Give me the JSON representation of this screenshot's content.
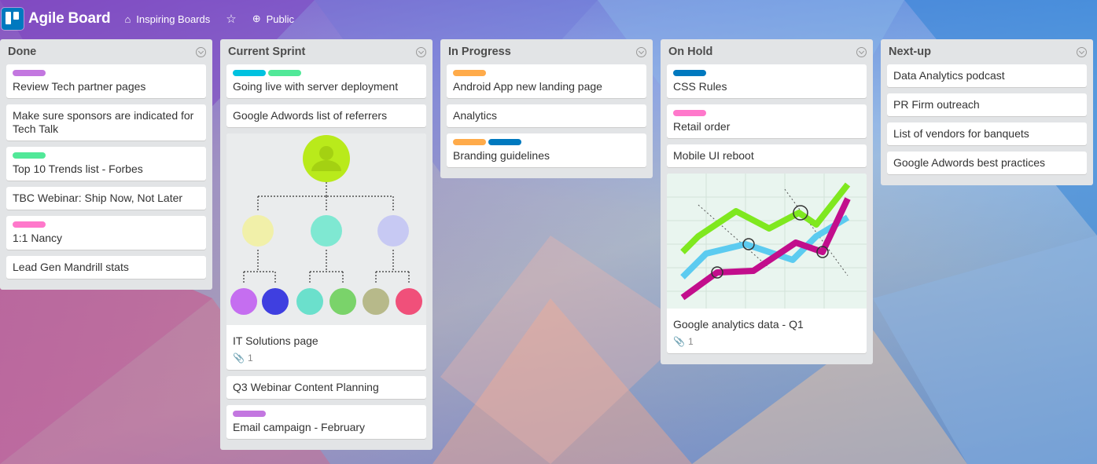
{
  "header": {
    "board_title": "Agile Board",
    "team": "Inspiring Boards",
    "visibility": "Public",
    "icons": [
      "trello-logo-icon",
      "team-icon",
      "star-icon",
      "globe-icon"
    ]
  },
  "lists": [
    {
      "title": "Done",
      "cards": [
        {
          "title": "Review Tech partner pages",
          "labels": [
            "#c377e0"
          ]
        },
        {
          "title": "Make sure sponsors are indicated for Tech Talk",
          "labels": []
        },
        {
          "title": "Top 10 Trends list - Forbes",
          "labels": [
            "#51e898"
          ]
        },
        {
          "title": "TBC Webinar: Ship Now, Not Later",
          "labels": []
        },
        {
          "title": "1:1 Nancy",
          "labels": [
            "#ff78cb"
          ]
        },
        {
          "title": "Lead Gen Mandrill stats",
          "labels": []
        }
      ]
    },
    {
      "title": "Current Sprint",
      "cards": [
        {
          "title": "Going live with server deployment",
          "labels": [
            "#00c2e0",
            "#51e898"
          ]
        },
        {
          "title": "Google Adwords list of referrers",
          "labels": []
        },
        {
          "title": "IT Solutions page",
          "labels": [],
          "cover": "org-chart",
          "attachments": "1"
        },
        {
          "title": "Q3 Webinar Content Planning",
          "labels": []
        },
        {
          "title": "Email campaign - February",
          "labels": [
            "#c377e0"
          ]
        }
      ]
    },
    {
      "title": "In Progress",
      "cards": [
        {
          "title": "Android App new landing page",
          "labels": [
            "#ffab4a"
          ]
        },
        {
          "title": "Analytics",
          "labels": []
        },
        {
          "title": "Branding guidelines",
          "labels": [
            "#ffab4a",
            "#0079bf"
          ]
        }
      ]
    },
    {
      "title": "On Hold",
      "cards": [
        {
          "title": "CSS Rules",
          "labels": [
            "#0079bf"
          ]
        },
        {
          "title": "Retail order",
          "labels": [
            "#ff78cb"
          ]
        },
        {
          "title": "Mobile UI reboot",
          "labels": []
        },
        {
          "title": "Google analytics data - Q1",
          "labels": [],
          "cover": "line-chart",
          "attachments": "1"
        }
      ]
    },
    {
      "title": "Next-up",
      "cards": [
        {
          "title": "Data Analytics podcast",
          "labels": []
        },
        {
          "title": "PR Firm outreach",
          "labels": []
        },
        {
          "title": "List of vendors for banquets",
          "labels": []
        },
        {
          "title": "Google Adwords best practices",
          "labels": []
        }
      ]
    }
  ]
}
